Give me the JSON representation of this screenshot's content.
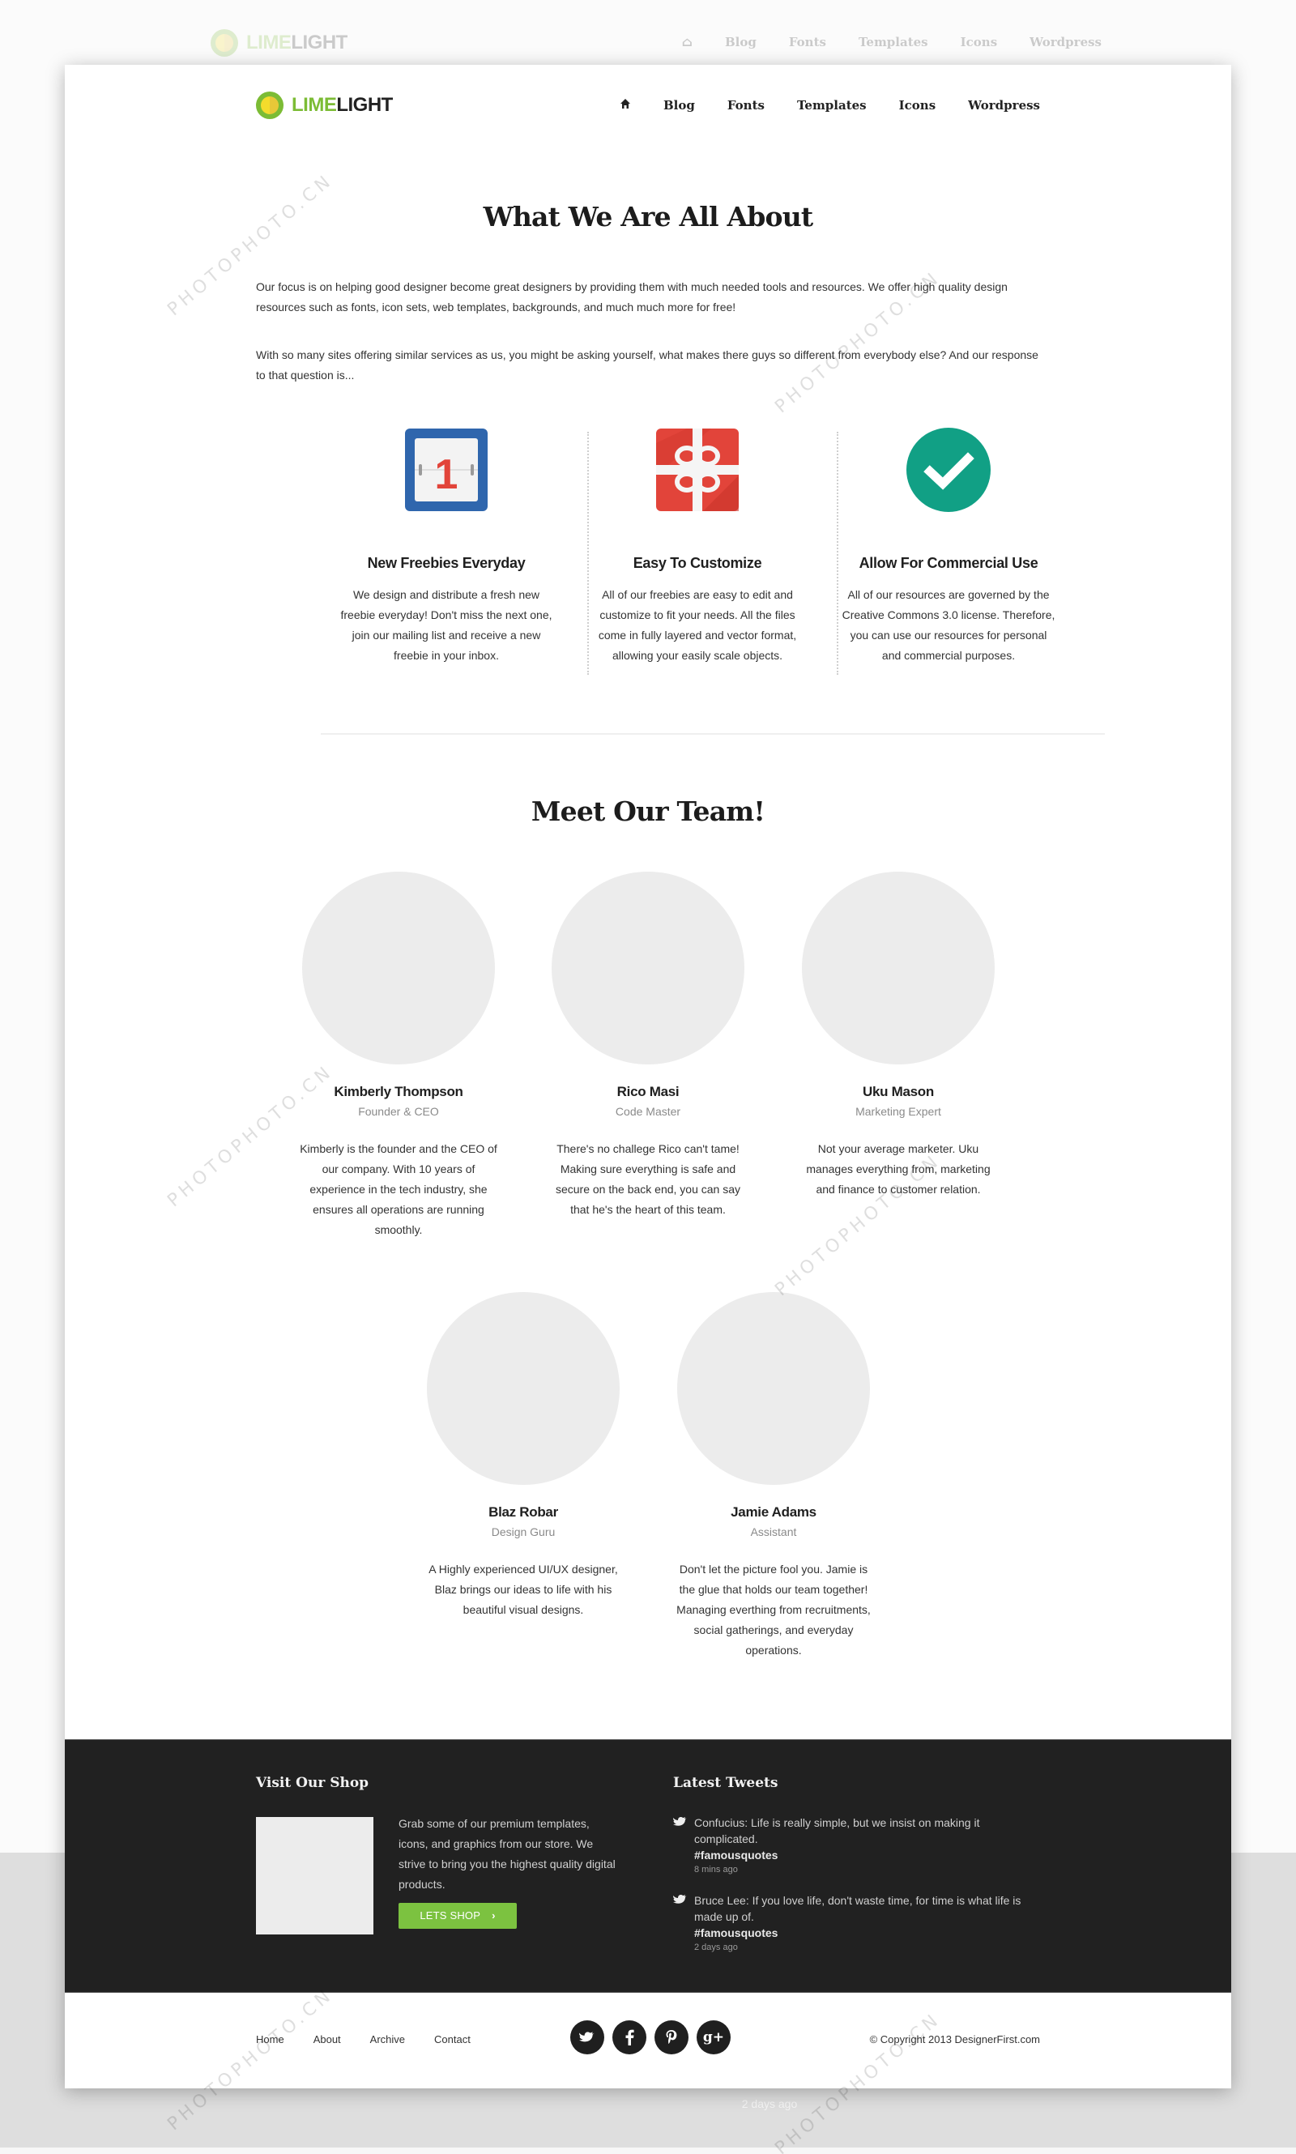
{
  "header": {
    "logo": {
      "part1": "LIME",
      "part2": "LIGHT"
    },
    "nav": [
      {
        "label": "Blog"
      },
      {
        "label": "Fonts"
      },
      {
        "label": "Templates"
      },
      {
        "label": "Icons"
      },
      {
        "label": "Wordpress"
      }
    ],
    "home_icon": "home-icon"
  },
  "about": {
    "title": "What We Are All About",
    "paragraphs": [
      "Our focus is on helping good designer become great designers by providing them with much needed tools and resources. We offer high quality design resources such as fonts, icon sets, web templates, backgrounds, and much much more for free!",
      "With so many sites offering similar services as us, you might be asking yourself, what makes there guys so different from everybody else? And our response to that question is..."
    ],
    "features": [
      {
        "icon": "calendar-icon",
        "icon_text": "1",
        "title": "New Freebies Everyday",
        "desc": "We design and distribute a fresh new freebie everyday! Don't miss the next one, join our mailing list and receive a new freebie in your inbox."
      },
      {
        "icon": "gift-icon",
        "title": "Easy To Customize",
        "desc": "All of our freebies are easy to edit and customize to fit your needs. All the files come in fully layered and vector format, allowing your easily scale objects."
      },
      {
        "icon": "checkmark-icon",
        "title": "Allow For Commercial Use",
        "desc": "All of our resources are governed by the Creative Commons 3.0 license. Therefore, you can use our resources for personal and commercial purposes."
      }
    ]
  },
  "team": {
    "title": "Meet Our Team!",
    "members": [
      {
        "name": "Kimberly Thompson",
        "role": "Founder & CEO",
        "bio": "Kimberly is the founder and the CEO of our company. With 10 years of experience in the tech industry, she ensures all operations are running smoothly."
      },
      {
        "name": "Rico Masi",
        "role": "Code Master",
        "bio": "There's no challege Rico can't tame! Making sure everything is safe and secure on the back end, you can say that he's the heart of this team."
      },
      {
        "name": "Uku Mason",
        "role": "Marketing Expert",
        "bio": "Not your average marketer. Uku manages everything from, marketing and finance to customer relation."
      },
      {
        "name": "Blaz Robar",
        "role": "Design Guru",
        "bio": "A Highly experienced UI/UX designer, Blaz brings our ideas to life with his beautiful visual designs."
      },
      {
        "name": "Jamie Adams",
        "role": "Assistant",
        "bio": "Don't let the picture fool you. Jamie is the glue that holds our team together! Managing everthing from recruitments, social gatherings, and everyday operations."
      }
    ]
  },
  "footer": {
    "shop": {
      "title": "Visit Our Shop",
      "text": "Grab some of our premium templates, icons, and graphics from our store. We strive to bring you the highest quality digital products.",
      "button": "LETS SHOP",
      "button_icon": "chevron-right-icon"
    },
    "tweets": {
      "title": "Latest Tweets",
      "items": [
        {
          "text": "Confucius: Life is really simple, but we insist on making it complicated.",
          "tag": "#famousquotes",
          "time": "8 mins ago"
        },
        {
          "text": "Bruce Lee: If you love life, don't waste time, for time is what life is made up of.",
          "tag": "#famousquotes",
          "time": "2 days ago"
        }
      ]
    },
    "links": [
      "Home",
      "About",
      "Archive",
      "Contact"
    ],
    "socials": [
      {
        "name": "twitter-icon",
        "glyph": "t"
      },
      {
        "name": "facebook-icon",
        "glyph": "f"
      },
      {
        "name": "pinterest-icon",
        "glyph": "p"
      },
      {
        "name": "google-plus-icon",
        "glyph": "g+"
      }
    ],
    "copyright": "© Copyright 2013 DesignerFirst.com",
    "ghost_time": "2 days ago"
  },
  "colors": {
    "brand_green": "#7cbc35",
    "button_green": "#7cc240",
    "dark_footer": "#212121",
    "calendar_blue": "#2f66ad",
    "gift_red": "#e2443a",
    "check_teal": "#11a085"
  }
}
